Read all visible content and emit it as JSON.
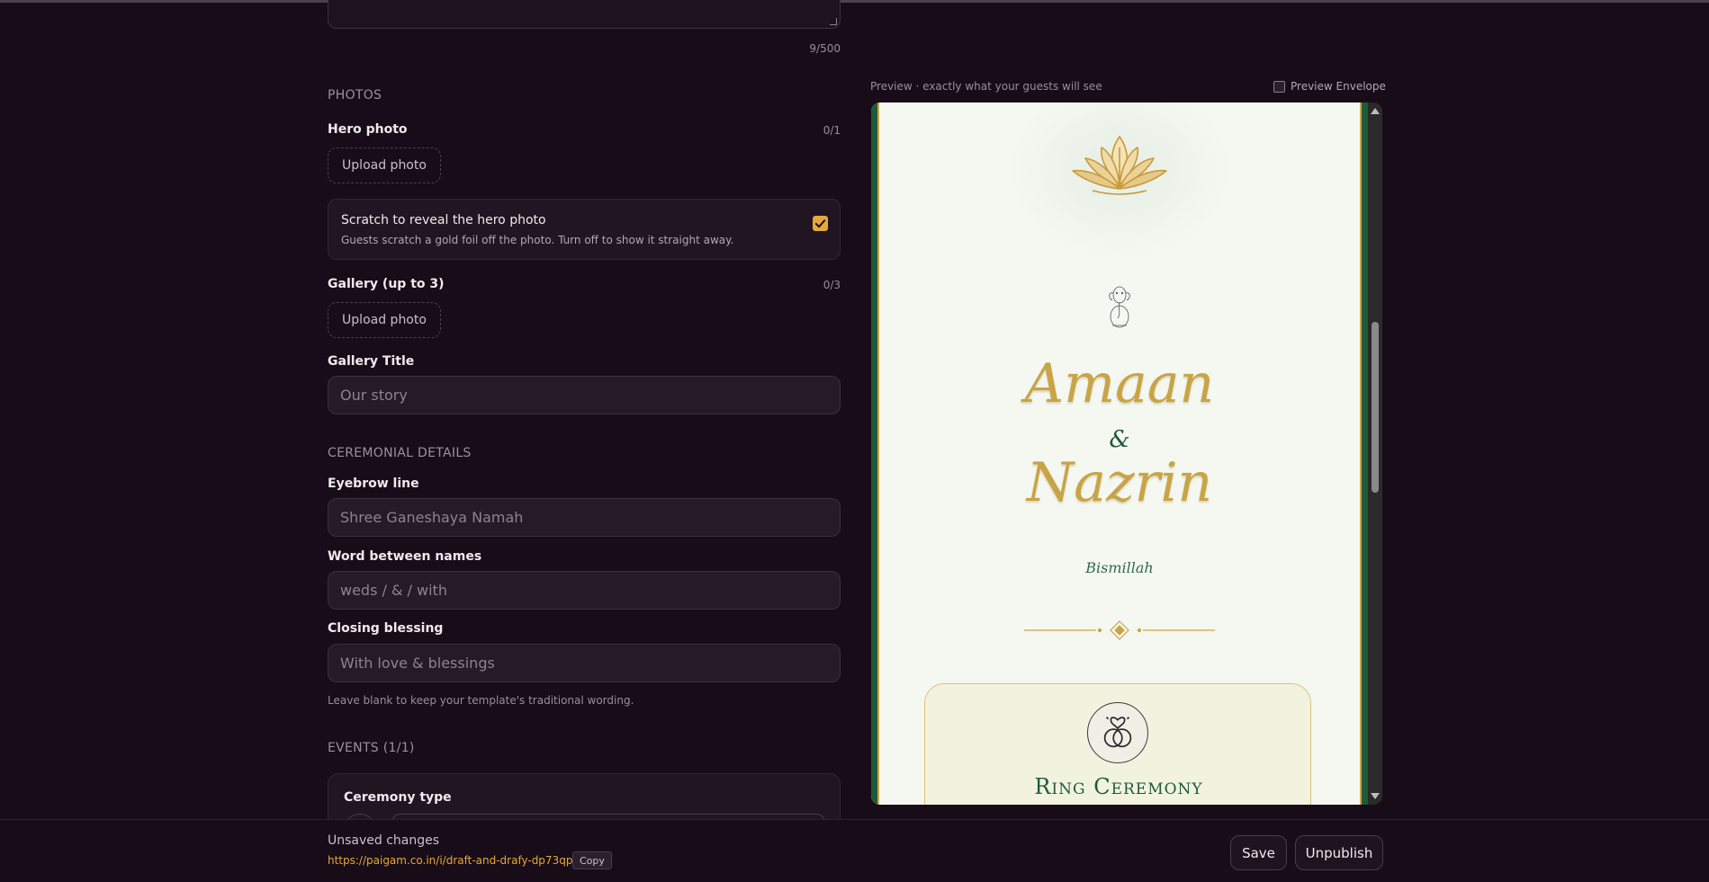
{
  "form": {
    "message_counter": "9/500",
    "photos": {
      "section_title": "PHOTOS",
      "hero_label": "Hero photo",
      "hero_counter": "0/1",
      "upload_label": "Upload photo",
      "scratch_title": "Scratch to reveal the hero photo",
      "scratch_desc": "Guests scratch a gold foil off the photo. Turn off to show it straight away.",
      "scratch_enabled": true,
      "gallery_label": "Gallery (up to 3)",
      "gallery_counter": "0/3",
      "gallery_upload_label": "Upload photo",
      "gallery_title_label": "Gallery Title",
      "gallery_title_placeholder": "Our story"
    },
    "ceremonial": {
      "section_title": "CEREMONIAL DETAILS",
      "eyebrow_label": "Eyebrow line",
      "eyebrow_placeholder": "Shree Ganeshaya Namah",
      "word_label": "Word between names",
      "word_placeholder": "weds / & / with",
      "closing_label": "Closing blessing",
      "closing_placeholder": "With love & blessings",
      "hint": "Leave blank to keep your template's traditional wording."
    },
    "events": {
      "section_title": "EVENTS (1/1)",
      "ceremony_type_label": "Ceremony type"
    }
  },
  "preview": {
    "caption": "Preview · exactly what your guests will see",
    "envelope_label": "Preview Envelope",
    "envelope_checked": false,
    "invite": {
      "name1": "Amaan",
      "connector": "&",
      "name2": "Nazrin",
      "blessing": "Bismillah",
      "event_title": "Ring Ceremony"
    },
    "colors": {
      "gold": "#c9a446",
      "green": "#1e5a3a",
      "paper": "#f4f8f1"
    }
  },
  "footer": {
    "status": "Unsaved changes",
    "link": "https://paigam.co.in/i/draft-and-drafy-dp73qp",
    "copy_label": "Copy",
    "save_label": "Save",
    "unpublish_label": "Unpublish"
  }
}
